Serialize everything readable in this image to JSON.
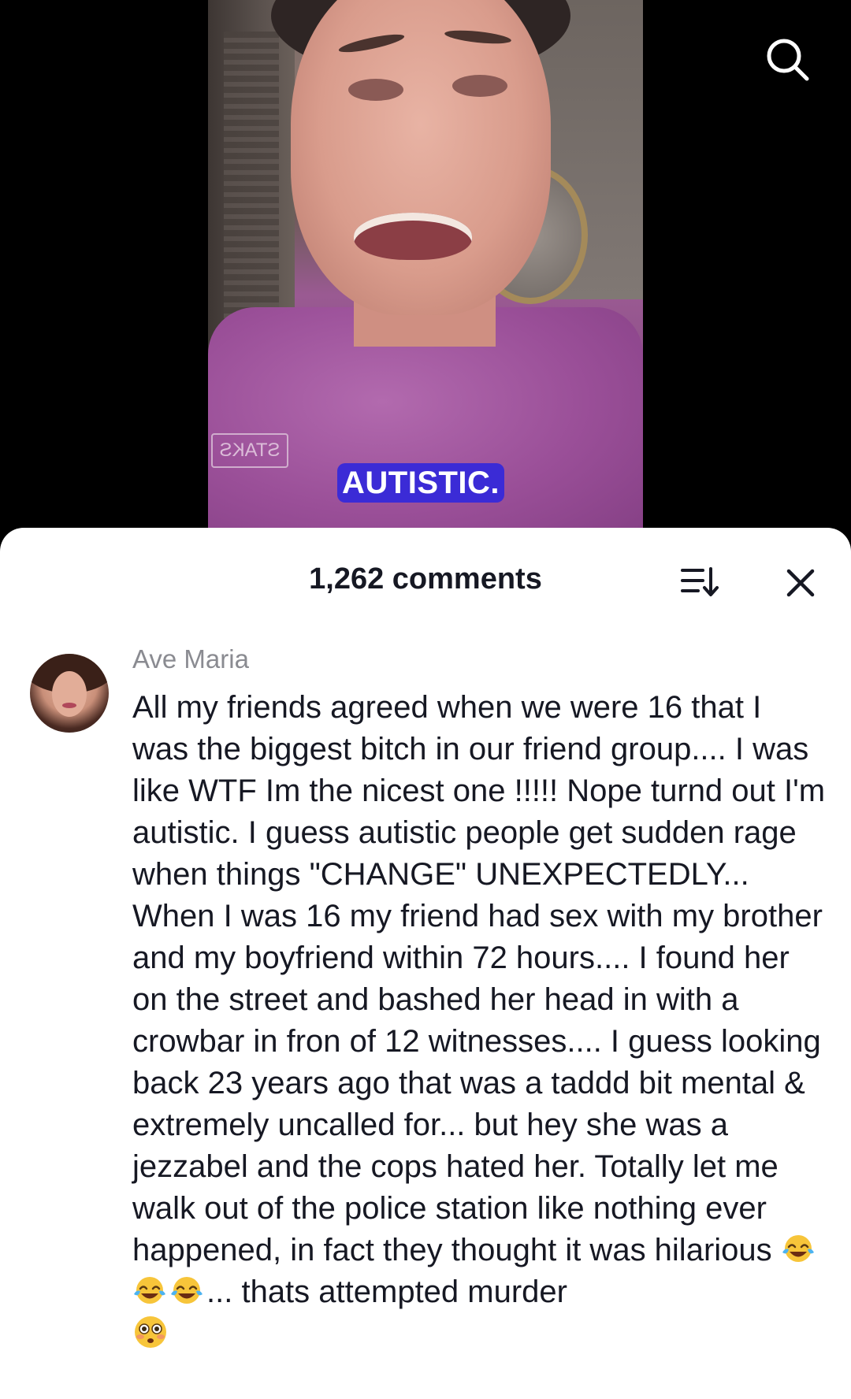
{
  "video": {
    "caption": "AUTISTIC.",
    "shirt_tag": "STAKS"
  },
  "top_bar": {
    "search_icon": "search-icon"
  },
  "comments_panel": {
    "title": "1,262 comments",
    "sort_icon": "sort-icon",
    "close_icon": "close-icon"
  },
  "comment": {
    "username": "Ave Maria",
    "text_main": "All my friends agreed when we were 16 that I was the biggest bitch in our friend group.... I was like WTF Im the nicest one !!!!! Nope turnd out I'm autistic. I guess autistic people get sudden rage when things \"CHANGE\" UNEXPECTEDLY... When I was 16 my friend had sex with my brother and my boyfriend within 72 hours.... I found her on the street and bashed her head in with a crowbar in fron of 12 witnesses.... I guess looking back 23 years ago that was a taddd bit mental & extremely uncalled for... but hey she was a jezzabel and the cops hated her. Totally let me walk out of the police station like nothing ever happened, in fact they thought it was hilarious ",
    "text_tail": "... thats attempted murder",
    "emojis": [
      "face-with-tears-of-joy",
      "face-with-tears-of-joy",
      "face-with-tears-of-joy",
      "flushed-face"
    ]
  },
  "colors": {
    "caption_bg": "#3b2bd6",
    "text_primary": "#161823",
    "text_secondary": "#8a8b91"
  }
}
